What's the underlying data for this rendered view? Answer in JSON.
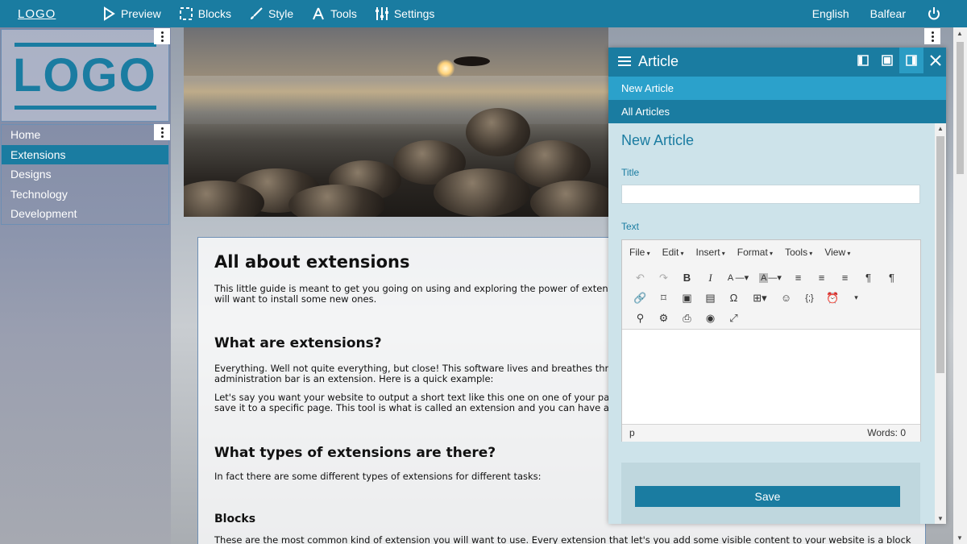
{
  "topbar": {
    "logo": "LOGO",
    "items": [
      {
        "label": "Preview",
        "icon": "play-icon"
      },
      {
        "label": "Blocks",
        "icon": "blocks-icon"
      },
      {
        "label": "Style",
        "icon": "brush-icon"
      },
      {
        "label": "Tools",
        "icon": "tools-icon"
      },
      {
        "label": "Settings",
        "icon": "sliders-icon"
      }
    ],
    "language": "English",
    "user": "Balfear",
    "power_icon": "power-icon"
  },
  "sidebar": {
    "logo_text": "LOGO",
    "nav": [
      {
        "label": "Home",
        "active": false
      },
      {
        "label": "Extensions",
        "active": true
      },
      {
        "label": "Designs",
        "active": false
      },
      {
        "label": "Technology",
        "active": false
      },
      {
        "label": "Development",
        "active": false
      }
    ]
  },
  "article": {
    "h1": "All about extensions",
    "intro": "This little guide is meant to get you going on using and exploring the power of extensions.",
    "intro2": "will want to install some new ones.",
    "h2a": "What are extensions?",
    "p1a": "Everything. Well not quite everything, but close! This software lives and breathes through",
    "p1b": "administration bar is an extension. Here is a quick example:",
    "p2a": "Let's say you want your website to output a short text like this one on one of your pages.",
    "p2b": "save it to a specific page. This tool is what is called an extension and you can have as mar",
    "h2b": "What types of extensions are there?",
    "p3": "In fact there are some different types of extensions for different tasks:",
    "h3": "Blocks",
    "p4": "These are the most common kind of extension you will want to use. Every extension that let's you add some visible content to your website is a block"
  },
  "panel": {
    "title": "Article",
    "tabs": [
      "New Article",
      "All Articles"
    ],
    "heading": "New Article",
    "title_label": "Title",
    "title_value": "",
    "text_label": "Text",
    "editor_menus": [
      "File",
      "Edit",
      "Insert",
      "Format",
      "Tools",
      "View"
    ],
    "status_path": "p",
    "word_count": "Words: 0",
    "save_label": "Save"
  },
  "colors": {
    "accent": "#1a7ca1",
    "accent_light": "#2ba1cb",
    "panel_bg": "#cde3ea"
  }
}
